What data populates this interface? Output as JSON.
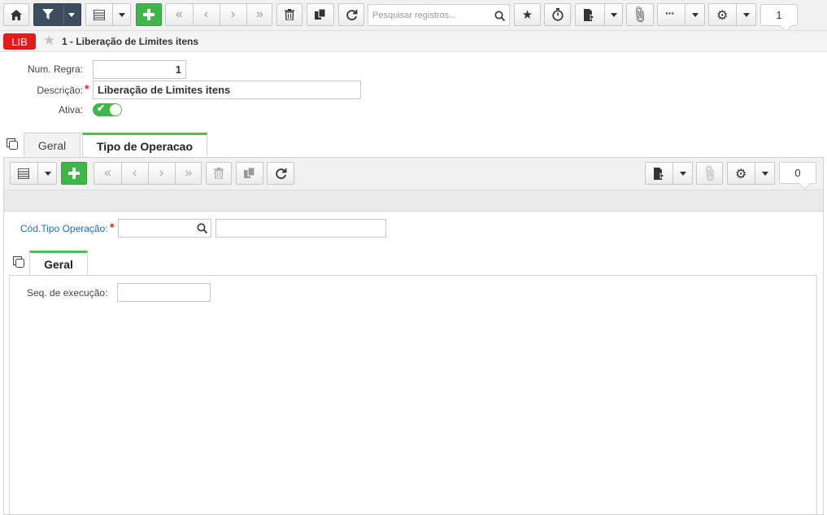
{
  "toolbar": {
    "search_placeholder": "Pesquisar registros...",
    "record_count": "1"
  },
  "header": {
    "badge": "LIB",
    "title": "1 - Liberação de Limites itens"
  },
  "form": {
    "num_regra_label": "Num. Regra:",
    "num_regra_value": "1",
    "descricao_label": "Descrição:",
    "descricao_value": "Liberação de Limites itens",
    "ativa_label": "Ativa:",
    "ativa_on": true
  },
  "tabs": [
    {
      "label": "Geral",
      "active": false
    },
    {
      "label": "Tipo de Operacao",
      "active": true
    }
  ],
  "sub_toolbar": {
    "record_count": "0"
  },
  "sub_form": {
    "cod_tipo_label": "Cód.Tipo Operação:",
    "cod_tipo_value": "",
    "cod_tipo_desc": ""
  },
  "inner_tabs": [
    {
      "label": "Geral",
      "active": true
    }
  ],
  "inner_form": {
    "seq_label": "Seq. de execução:",
    "seq_value": ""
  },
  "colors": {
    "accent_green": "#3fb54a",
    "dark_button": "#3d4c5f",
    "badge_red": "#e31b1b",
    "link_blue": "#1a6bc4"
  }
}
